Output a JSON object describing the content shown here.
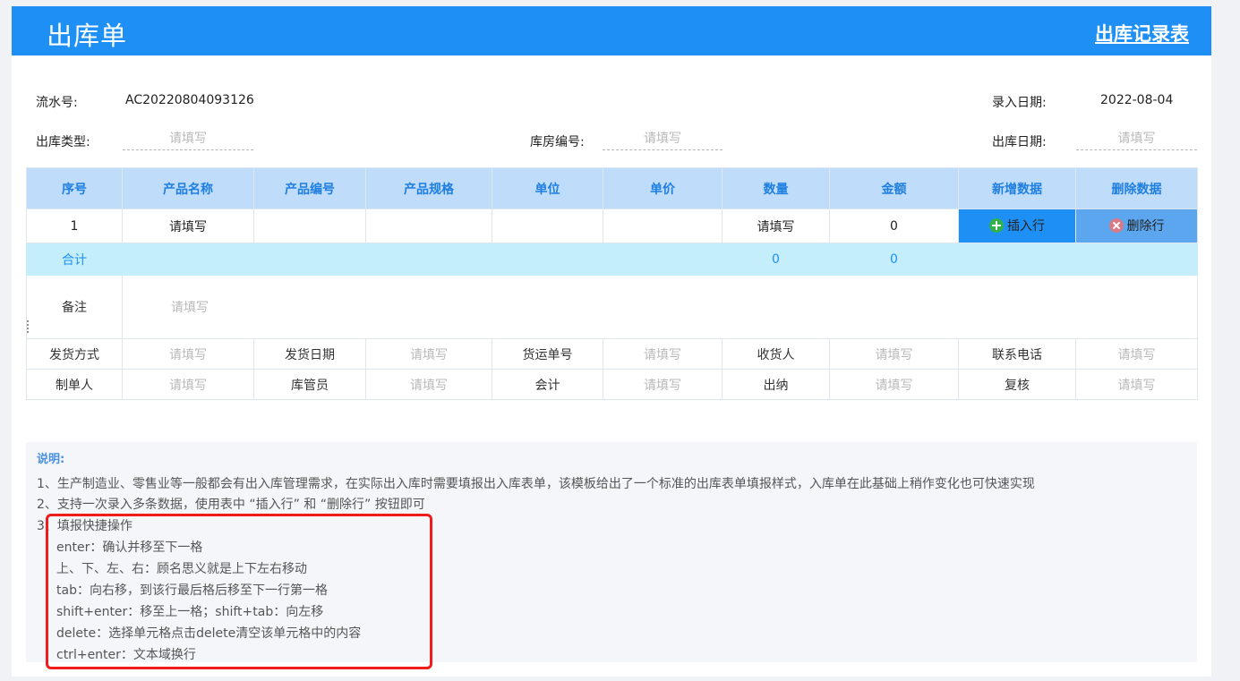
{
  "header": {
    "title": "出库单",
    "record_link": "出库记录表"
  },
  "meta": {
    "serial_label": "流水号:",
    "serial_value": "AC20220804093126",
    "entry_date_label": "录入日期:",
    "entry_date_value": "2022-08-04",
    "out_type_label": "出库类型:",
    "warehouse_label": "库房编号:",
    "out_date_label": "出库日期:",
    "placeholder": "请填写"
  },
  "table": {
    "headers": [
      "序号",
      "产品名称",
      "产品编号",
      "产品规格",
      "单位",
      "单价",
      "数量",
      "金额",
      "新增数据",
      "删除数据"
    ],
    "row": {
      "index": "1",
      "amount": "0"
    },
    "insert_label": "插入行",
    "delete_label": "删除行",
    "total": {
      "label": "合计",
      "qty": "0",
      "amount": "0"
    },
    "remark_label": "备注",
    "info_row1": [
      "发货方式",
      "发货日期",
      "货运单号",
      "收货人",
      "联系电话"
    ],
    "info_row2": [
      "制单人",
      "库管员",
      "会计",
      "出纳",
      "复核"
    ]
  },
  "notes": {
    "title": "说明:",
    "line1": "1、生产制造业、零售业等一般都会有出入库管理需求，在实际出入库时需要填报出入库表单，该模板给出了一个标准的出库表单填报样式，入库单在此基础上稍作变化也可快速实现",
    "line2": "2、支持一次录入多条数据，使用表中 “插入行” 和 “删除行” 按钮即可",
    "line3": "3、填报快捷操作",
    "sub": [
      "enter：确认并移至下一格",
      "上、下、左、右：顾名思义就是上下左右移动",
      "tab：向右移，到该行最后格后移至下一行第一格",
      "shift+enter：移至上一格；shift+tab：向左移",
      "delete：选择单元格点击delete清空该单元格中的内容",
      "ctrl+enter：文本域换行"
    ]
  }
}
